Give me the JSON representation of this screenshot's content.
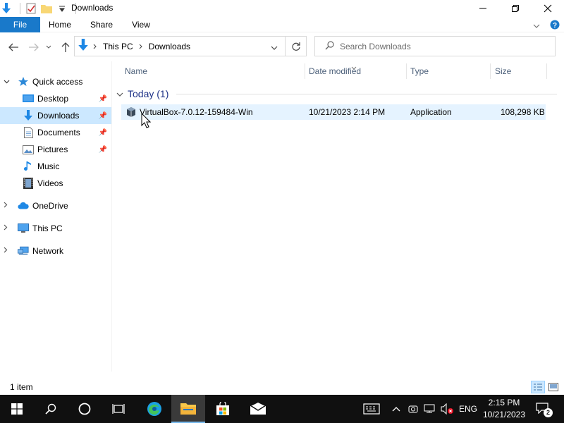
{
  "window": {
    "title": "Downloads",
    "qat_icons": [
      "down-arrow-icon",
      "properties-icon",
      "new-folder-icon",
      "customize-qat-icon"
    ]
  },
  "ribbon": {
    "tabs": [
      "File",
      "Home",
      "Share",
      "View"
    ],
    "accent": "#1979ca"
  },
  "address": {
    "crumbs": [
      "This PC",
      "Downloads"
    ],
    "search_placeholder": "Search Downloads"
  },
  "sidebar": {
    "quick_access": "Quick access",
    "items": [
      {
        "label": "Desktop",
        "icon": "desktop-icon",
        "pinned": true
      },
      {
        "label": "Downloads",
        "icon": "downloads-icon",
        "pinned": true,
        "selected": true
      },
      {
        "label": "Documents",
        "icon": "documents-icon",
        "pinned": true
      },
      {
        "label": "Pictures",
        "icon": "pictures-icon",
        "pinned": true
      },
      {
        "label": "Music",
        "icon": "music-icon",
        "pinned": false
      },
      {
        "label": "Videos",
        "icon": "videos-icon",
        "pinned": false
      }
    ],
    "roots": [
      {
        "label": "OneDrive",
        "icon": "onedrive-icon"
      },
      {
        "label": "This PC",
        "icon": "this-pc-icon"
      },
      {
        "label": "Network",
        "icon": "network-icon"
      }
    ]
  },
  "columns": [
    "Name",
    "Date modified",
    "Type",
    "Size"
  ],
  "group": {
    "label": "Today (1)"
  },
  "files": [
    {
      "name": "VirtualBox-7.0.12-159484-Win",
      "date": "10/21/2023 2:14 PM",
      "type": "Application",
      "size": "108,298 KB"
    }
  ],
  "status": {
    "count": "1 item"
  },
  "taskbar": {
    "language": "ENG",
    "time": "2:15 PM",
    "date": "10/21/2023",
    "notifications": "2"
  }
}
